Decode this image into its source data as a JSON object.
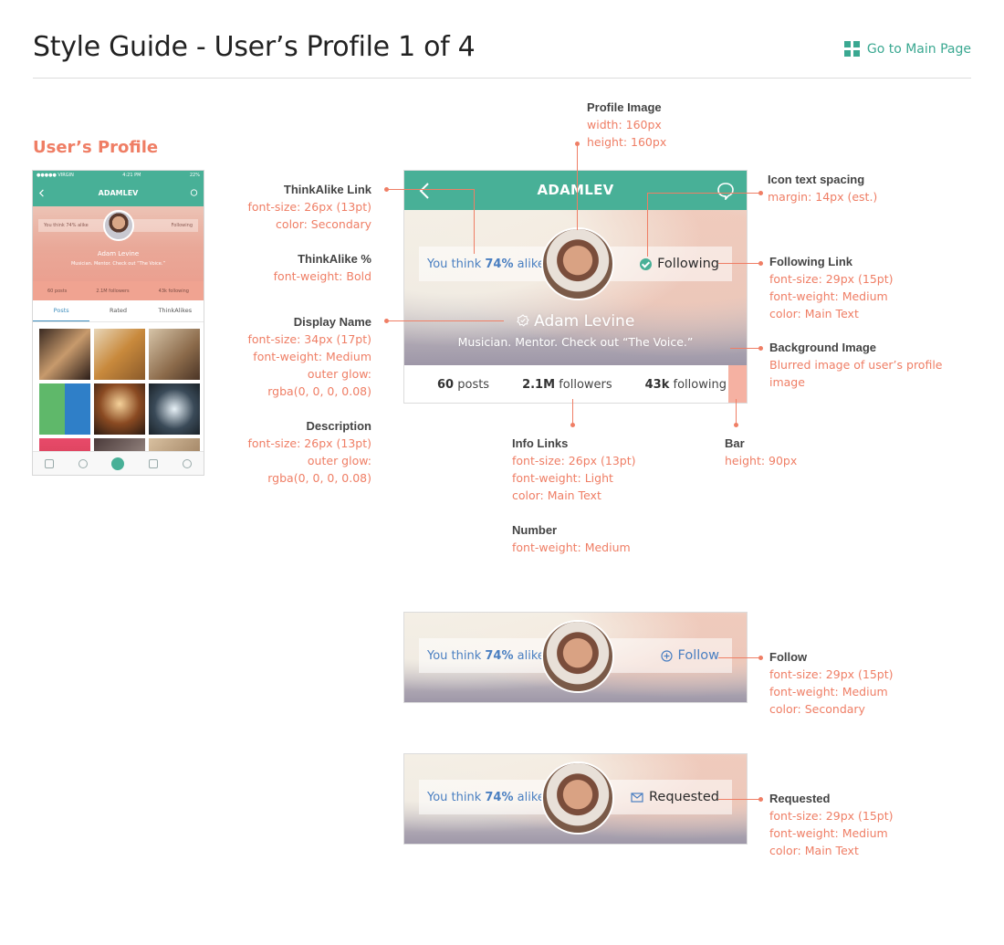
{
  "header": {
    "title": "Style Guide - User’s Profile 1 of 4",
    "goto_label": "Go to Main Page",
    "section_title": "User’s Profile"
  },
  "phone": {
    "carrier": "●●●●● VIRGIN",
    "time": "4:21 PM",
    "battery": "22%",
    "nav_title": "ADAMLEV",
    "alike": "You think 74% alike",
    "following": "Following",
    "name": "Adam Levine",
    "description": "Musician. Mentor. Check out “The Voice.”",
    "stats": [
      "60 posts",
      "2.1M followers",
      "43k following"
    ],
    "tabs": [
      "Posts",
      "Rated",
      "ThinkAlikes"
    ]
  },
  "profile": {
    "nav_title": "ADAMLEV",
    "alike_prefix": "You think ",
    "alike_pct": "74%",
    "alike_suffix": " alike",
    "following_label": "Following",
    "follow_label": "Follow",
    "requested_label": "Requested",
    "display_name": "Adam Levine",
    "description": "Musician. Mentor. Check out “The Voice.”",
    "posts_num": "60",
    "posts_label": "posts",
    "followers_num": "2.1M",
    "followers_label": "followers",
    "following_num": "43k",
    "following_label2": "following"
  },
  "annotations": {
    "profile_image": {
      "h": "Profile Image",
      "v": [
        "width: 160px",
        "height: 160px"
      ]
    },
    "thinkalike_link": {
      "h": "ThinkAlike Link",
      "v": [
        "font-size: 26px (13pt)",
        "color: Secondary"
      ]
    },
    "thinkalike_pct": {
      "h": "ThinkAlike %",
      "v": [
        "font-weight: Bold"
      ]
    },
    "display_name": {
      "h": "Display Name",
      "v": [
        "font-size: 34px (17pt)",
        "font-weight: Medium",
        "outer glow:",
        "rgba(0, 0, 0, 0.08)"
      ]
    },
    "description": {
      "h": "Description",
      "v": [
        "font-size: 26px (13pt)",
        "outer glow:",
        "rgba(0, 0, 0, 0.08)"
      ]
    },
    "icon_spacing": {
      "h": "Icon text spacing",
      "v": [
        "margin: 14px (est.)"
      ]
    },
    "following_link": {
      "h": "Following Link",
      "v": [
        "font-size: 29px (15pt)",
        "font-weight: Medium",
        "color: Main Text"
      ]
    },
    "background_image": {
      "h": "Background Image",
      "v": [
        "Blurred image of user’s profile",
        "image"
      ]
    },
    "info_links": {
      "h": "Info Links",
      "v": [
        "font-size: 26px (13pt)",
        "font-weight: Light",
        "color: Main Text"
      ]
    },
    "number": {
      "h": "Number",
      "v": [
        "font-weight: Medium"
      ]
    },
    "bar": {
      "h": "Bar",
      "v": [
        "height: 90px"
      ]
    },
    "follow": {
      "h": "Follow",
      "v": [
        "font-size: 29px (15pt)",
        "font-weight: Medium",
        "color: Secondary"
      ]
    },
    "requested": {
      "h": "Requested",
      "v": [
        "font-size: 29px (15pt)",
        "font-weight: Medium",
        "color: Main Text"
      ]
    }
  },
  "colors": {
    "primary": "#48b097",
    "annotation": "#ef7e65",
    "secondary": "#4a7fc1",
    "bar": "#f5b1a2"
  }
}
